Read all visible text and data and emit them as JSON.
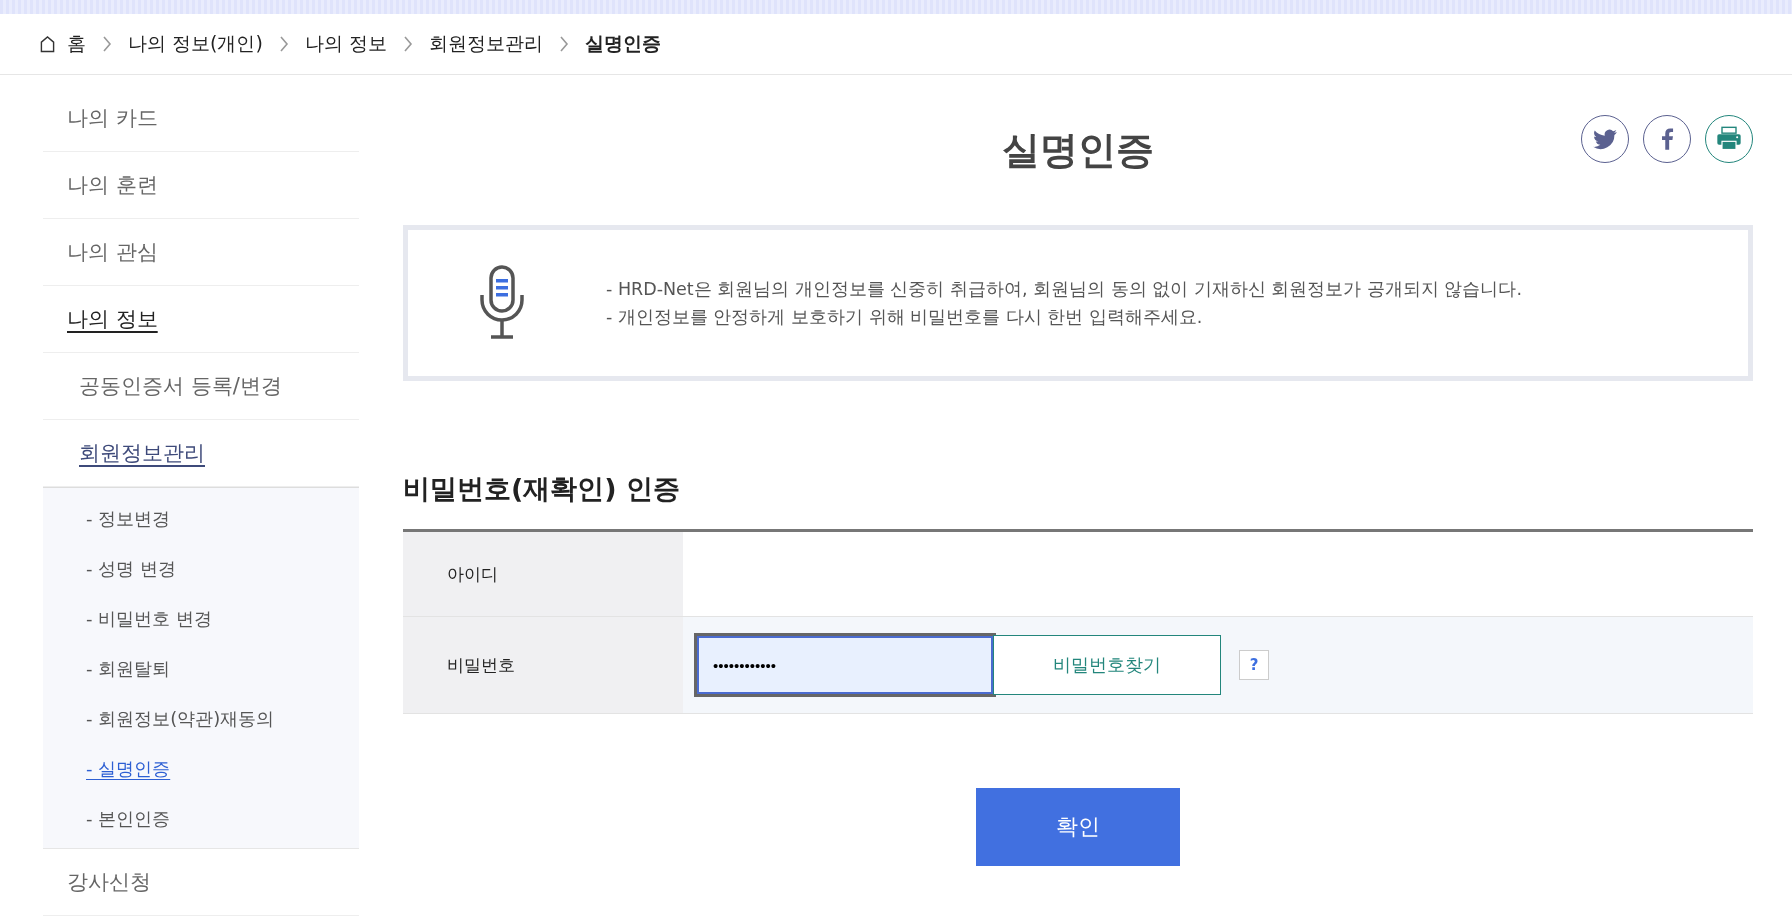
{
  "breadcrumb": [
    {
      "label": "홈",
      "kind": "home"
    },
    {
      "label": "나의 정보(개인)",
      "kind": "link"
    },
    {
      "label": "나의 정보",
      "kind": "link"
    },
    {
      "label": "회원정보관리",
      "kind": "link"
    },
    {
      "label": "실명인증",
      "kind": "current"
    }
  ],
  "sidebar": {
    "items": [
      {
        "label": "나의 카드",
        "selected": false
      },
      {
        "label": "나의 훈련",
        "selected": false
      },
      {
        "label": "나의 관심",
        "selected": false
      },
      {
        "label": "나의 정보",
        "selected": true,
        "children": [
          {
            "label": "공동인증서 등록/변경",
            "selected": false
          },
          {
            "label": "회원정보관리",
            "selected": true,
            "children": [
              {
                "label": "- 정보변경",
                "selected": false
              },
              {
                "label": "- 성명 변경",
                "selected": false
              },
              {
                "label": "- 비밀번호 변경",
                "selected": false
              },
              {
                "label": "- 회원탈퇴",
                "selected": false
              },
              {
                "label": "- 회원정보(약관)재동의",
                "selected": false
              },
              {
                "label": "- 실명인증",
                "selected": true
              },
              {
                "label": "- 본인인증",
                "selected": false
              }
            ]
          }
        ]
      },
      {
        "label": "강사신청",
        "selected": false
      }
    ]
  },
  "page_title": "실명인증",
  "share_buttons": [
    {
      "kind": "twitter"
    },
    {
      "kind": "facebook"
    },
    {
      "kind": "print"
    }
  ],
  "notice": {
    "lines": [
      "- HRD-Net은 회원님의 개인정보를 신중히 취급하여, 회원님의 동의 없이 기재하신 회원정보가 공개되지 않습니다.",
      "- 개인정보를 안정하게 보호하기 위해 비밀번호를 다시 한번 입력해주세요."
    ]
  },
  "form": {
    "heading": "비밀번호(재확인) 인증",
    "rows": [
      {
        "label": "아이디",
        "kind": "text"
      },
      {
        "label": "비밀번호",
        "kind": "password",
        "value": "••••••••••••",
        "focused": true,
        "button": "비밀번호찾기",
        "help": "?"
      }
    ]
  },
  "submit": "확인"
}
